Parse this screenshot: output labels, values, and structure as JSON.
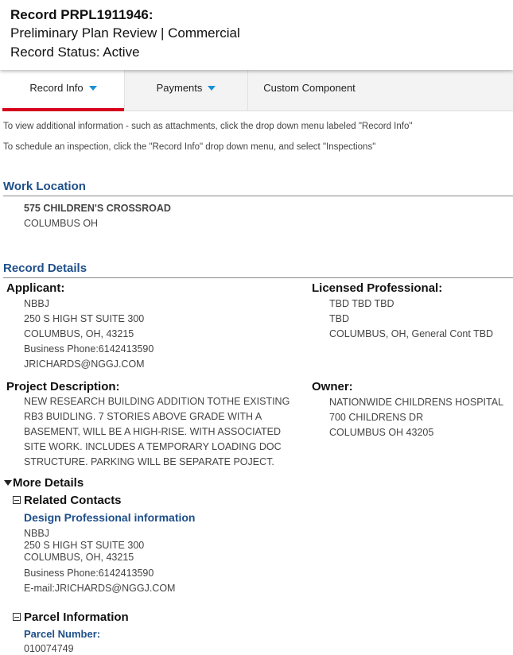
{
  "record": {
    "title": "Record PRPL1911946:",
    "type": "Preliminary Plan Review | Commercial",
    "status": "Record Status: Active"
  },
  "tabs": [
    {
      "label": "Record Info"
    },
    {
      "label": "Payments"
    },
    {
      "label": "Custom Component"
    }
  ],
  "notes": {
    "info": "To view additional information - such as attachments, click the drop down menu labeled \"Record Info\"",
    "inspection": "To schedule an inspection, click the \"Record Info\" drop down menu, and select \"Inspections\""
  },
  "work_location": {
    "title": "Work Location",
    "address1": "575 CHILDREN'S CROSSROAD",
    "address2": "COLUMBUS OH"
  },
  "record_details": {
    "title": "Record Details",
    "applicant": {
      "label": "Applicant:",
      "name": "NBBJ",
      "street": "250 S HIGH ST SUITE 300",
      "city": "COLUMBUS, OH, 43215",
      "phone": "Business Phone:6142413590",
      "email": "JRICHARDS@NGGJ.COM"
    },
    "licensed_professional": {
      "label": "Licensed Professional:",
      "name": "TBD TBD TBD",
      "company": "TBD",
      "city": "COLUMBUS, OH, General Cont TBD"
    },
    "project_description": {
      "label": "Project Description:",
      "lines": [
        "NEW RESEARCH BUILDING ADDITION TOTHE EXISTING",
        "RB3 BUIDLING. 7 STORIES ABOVE GRADE WITH A",
        "BASEMENT, WILL BE A HIGH-RISE. WITH ASSOCIATED",
        "SITE WORK. INCLUDES A TEMPORARY LOADING DOC",
        "STRUCTURE. PARKING WILL BE SEPARATE POJECT."
      ]
    },
    "owner": {
      "label": "Owner:",
      "name": "NATIONWIDE CHILDRENS HOSPITAL",
      "street": "700 CHILDRENS DR",
      "city": "COLUMBUS OH 43205"
    }
  },
  "more_details": {
    "label": "More Details",
    "related_contacts": {
      "label": "Related Contacts",
      "subhead": "Design Professional information",
      "name": "NBBJ",
      "street": "250 S HIGH ST SUITE 300",
      "city": "COLUMBUS, OH, 43215",
      "phone": "Business Phone:6142413590",
      "email": "E-mail:JRICHARDS@NGGJ.COM"
    },
    "parcel_information": {
      "label": "Parcel Information",
      "subhead": "Parcel Number:",
      "number": "010074749"
    }
  }
}
